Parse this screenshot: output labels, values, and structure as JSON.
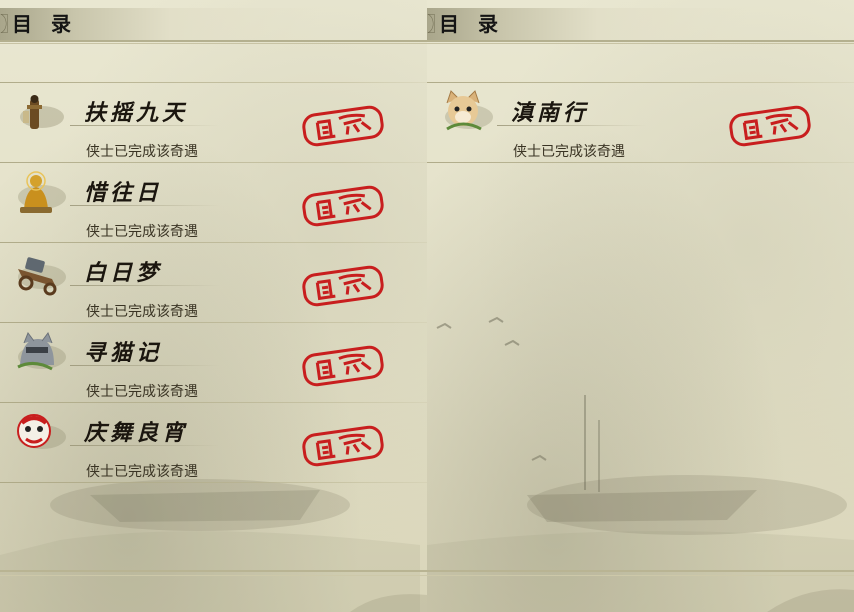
{
  "left_panel": {
    "title": "目 录",
    "entries": [
      {
        "name": "扶摇九天",
        "status": "侠士已完成该奇遇",
        "icon": "bamboo-figure-icon"
      },
      {
        "name": "惜往日",
        "status": "侠士已完成该奇遇",
        "icon": "golden-buddha-icon"
      },
      {
        "name": "白日梦",
        "status": "侠士已完成该奇遇",
        "icon": "cart-icon"
      },
      {
        "name": "寻猫记",
        "status": "侠士已完成该奇遇",
        "icon": "gray-cat-icon"
      },
      {
        "name": "庆舞良宵",
        "status": "侠士已完成该奇遇",
        "icon": "lion-dance-icon"
      }
    ]
  },
  "right_panel": {
    "title": "目 录",
    "entries": [
      {
        "name": "滇南行",
        "status": "侠士已完成该奇遇",
        "icon": "fox-cat-icon"
      }
    ]
  },
  "colors": {
    "stamp_red": "#c81e1e",
    "paper": "#e6e3cc",
    "title_text": "#141414"
  }
}
